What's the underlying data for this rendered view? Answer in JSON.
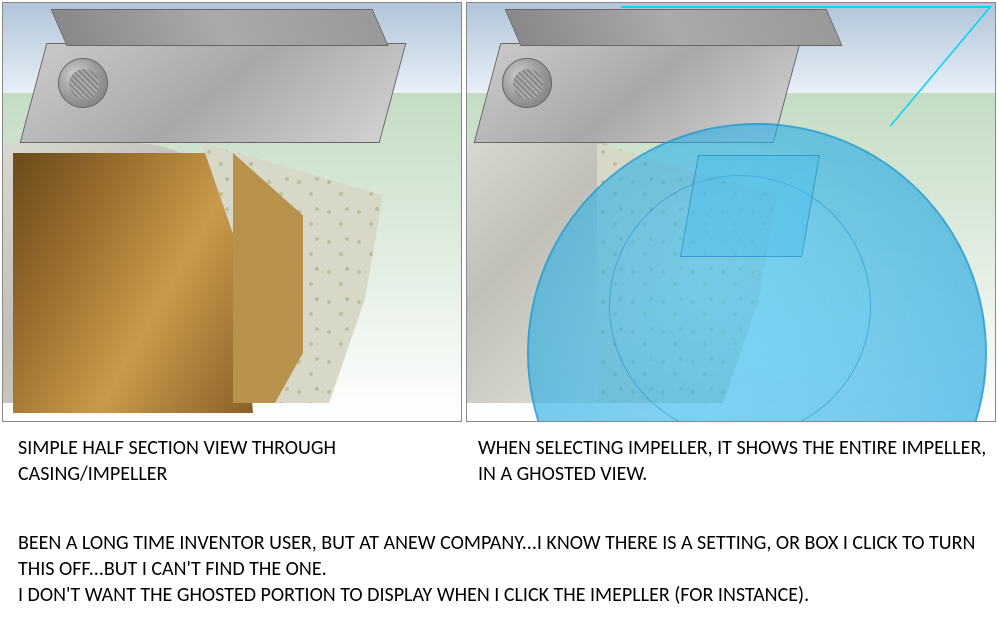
{
  "captions": {
    "left": "SIMPLE HALF SECTION VIEW THROUGH CASING/IMPELLER",
    "right": "WHEN SELECTING IMPELLER, IT SHOWS THE ENTIRE IMPELLER, IN A GHOSTED VIEW."
  },
  "body": {
    "line1": "BEEN A LONG TIME INVENTOR USER, BUT AT ANEW COMPANY...I KNOW THERE IS A SETTING, OR BOX I CLICK TO TURN THIS OFF...BUT I CAN'T FIND THE ONE.",
    "line2": "I DON'T WANT THE GHOSTED PORTION TO DISPLAY WHEN I CLICK THE IMEPLLER (FOR INSTANCE)."
  }
}
